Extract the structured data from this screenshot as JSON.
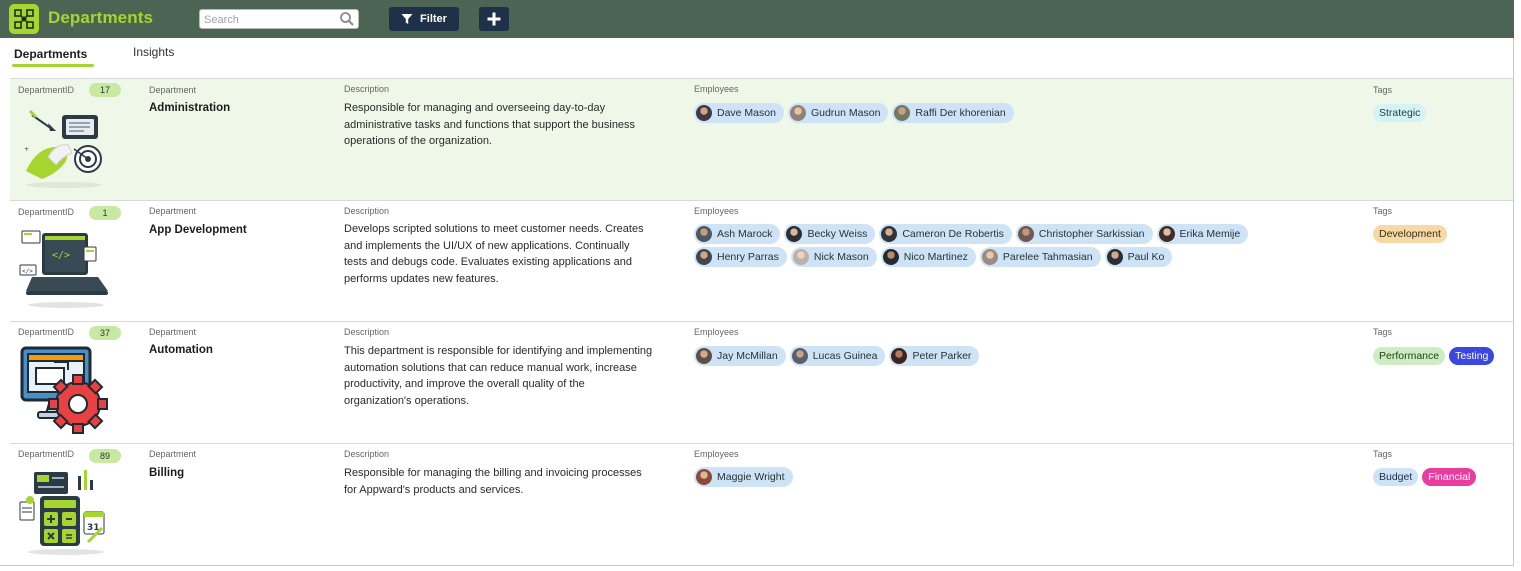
{
  "header": {
    "app_title": "Departments",
    "search_placeholder": "Search",
    "filter_label": "Filter",
    "add_icon": "plus-icon",
    "logo_icon": "network-logo-icon",
    "colors": {
      "bar": "#4b6454",
      "accent": "#a6d52f",
      "button": "#1e3148"
    }
  },
  "tabs": [
    {
      "label": "Departments",
      "active": true
    },
    {
      "label": "Insights",
      "active": false
    }
  ],
  "labels": {
    "id": "DepartmentID",
    "department": "Department",
    "description": "Description",
    "employees": "Employees",
    "tags": "Tags"
  },
  "departments": [
    {
      "id": "17",
      "name": "Administration",
      "description": "Responsible for managing and overseeing day-to-day administrative tasks and functions that support the business operations of the organization.",
      "image": "target-darts-illustration",
      "selected": true,
      "employees": [
        "Dave Mason",
        "Gudrun Mason",
        "Raffi Der khorenian"
      ],
      "tags": [
        {
          "label": "Strategic",
          "bg": "#d5f3f5",
          "color": "#1d3f44"
        }
      ]
    },
    {
      "id": "1",
      "name": "App Development",
      "description": "Develops scripted solutions to meet customer needs. Creates and implements the UI/UX of new applications. Continually tests and debugs code. Evaluates existing applications and performs updates new features.",
      "image": "laptop-code-illustration",
      "selected": false,
      "employees": [
        "Ash Marock",
        "Becky Weiss",
        "Cameron De Robertis",
        "Christopher Sarkissian",
        "Erika Memije",
        "Henry Parras",
        "Nick Mason",
        "Nico Martinez",
        "Parelee Tahmasian",
        "Paul Ko"
      ],
      "tags": [
        {
          "label": "Development",
          "bg": "#f6d9a4",
          "color": "#3b2e16"
        }
      ]
    },
    {
      "id": "37",
      "name": "Automation",
      "description": "This department is responsible for identifying and implementing automation solutions that can reduce manual work, increase productivity, and improve the overall quality of the organization's operations.",
      "image": "monitor-gear-illustration",
      "selected": false,
      "employees": [
        "Jay McMillan",
        "Lucas Guinea",
        "Peter Parker"
      ],
      "tags": [
        {
          "label": "Performance",
          "bg": "#cdeec2",
          "color": "#24401b"
        },
        {
          "label": "Testing",
          "bg": "#3a48e0",
          "color": "#ffffff"
        }
      ]
    },
    {
      "id": "89",
      "name": "Billing",
      "description": "Responsible for managing the billing and invoicing processes for Appward's products and services.",
      "image": "calculator-finance-illustration",
      "selected": false,
      "employees": [
        "Maggie Wright"
      ],
      "tags": [
        {
          "label": "Budget",
          "bg": "#cfe3f7",
          "color": "#1d2f44"
        },
        {
          "label": "Financial",
          "bg": "#e93c9f",
          "color": "#ffffff"
        }
      ]
    }
  ]
}
